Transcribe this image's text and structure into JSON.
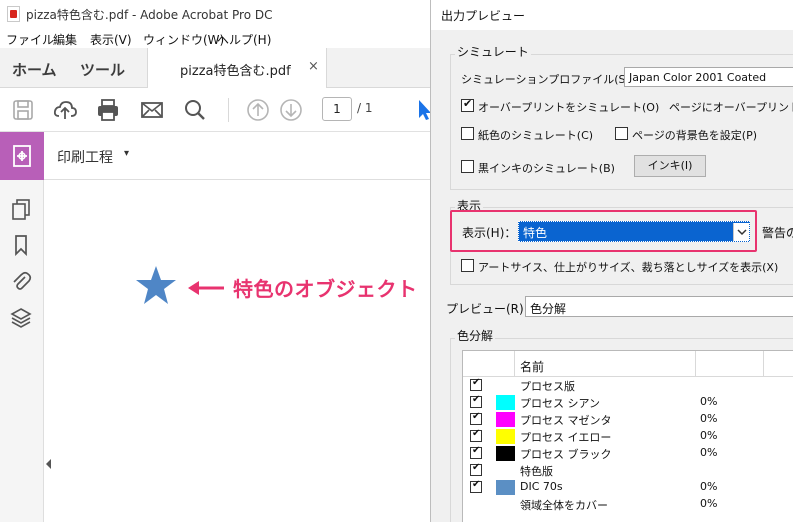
{
  "acrobat": {
    "title": "pizza特色含む.pdf - Adobe Acrobat Pro DC",
    "menu": [
      "ファイル",
      "編集",
      "表示(V)",
      "ウィンドウ(W)",
      "ヘルプ(H)"
    ],
    "nav": {
      "home": "ホーム",
      "tools": "ツール"
    },
    "doc_tab": {
      "label": "pizza特色含む.pdf",
      "close": "×"
    },
    "toolbar": {
      "icons": [
        "save-icon",
        "upload-icon",
        "print-icon",
        "mail-icon",
        "search-icon",
        "page-up-icon",
        "page-down-icon",
        "pointer-icon"
      ],
      "page_current": "1",
      "page_total": "/ 1"
    },
    "tool_strip": {
      "name": "印刷工程",
      "caret": "▾"
    },
    "left_rail_icons": [
      "pages-icon",
      "bookmark-icon",
      "attachment-icon",
      "layers-icon"
    ],
    "annotation": {
      "text": "特色のオブジェクト"
    },
    "colors": {
      "accent_purple": "#b85fb8",
      "star": "#4f86c6",
      "callout": "#e8336f",
      "pointer_blue": "#1a73e8"
    }
  },
  "dialog": {
    "title": "出力プレビュー",
    "simulate": {
      "group_label": "シミュレート",
      "profile_label": "シミュレーションプロファイル(S)：",
      "profile_value": "Japan Color 2001 Coated",
      "overprint_label": "オーバープリントをシミュレート(O)",
      "overprint_checked": true,
      "page_overprint_label": "ページにオーバープリント",
      "paper_color_label": "紙色のシミュレート(C)",
      "paper_color_checked": false,
      "page_bg_label": "ページの背景色を設定(P)",
      "page_bg_checked": false,
      "black_ink_label": "黒インキのシミュレート(B)",
      "black_ink_checked": false,
      "ink_button": "インキ(I)"
    },
    "display": {
      "group_label": "表示",
      "show_label": "表示(H)：",
      "show_value": "特色",
      "warning_label": "警告の",
      "boxes_label": "アートサイス、仕上がりサイズ、裁ち落としサイズを表示(X)",
      "boxes_checked": false
    },
    "preview": {
      "label": "プレビュー(R)：",
      "value": "色分解"
    },
    "separations": {
      "group_label": "色分解",
      "column_name": "名前",
      "rows": [
        {
          "name": "プロセス版",
          "checked": true,
          "swatch": "",
          "pct": ""
        },
        {
          "name": "プロセス シアン",
          "checked": true,
          "swatch": "#00ffff",
          "pct": "0%"
        },
        {
          "name": "プロセス マゼンタ",
          "checked": true,
          "swatch": "#ff00ff",
          "pct": "0%"
        },
        {
          "name": "プロセス イエロー",
          "checked": true,
          "swatch": "#ffff00",
          "pct": "0%"
        },
        {
          "name": "プロセス ブラック",
          "checked": true,
          "swatch": "#000000",
          "pct": "0%"
        },
        {
          "name": "特色版",
          "checked": true,
          "swatch": "",
          "pct": ""
        },
        {
          "name": "DIC 70s",
          "checked": true,
          "swatch": "#5b8fc4",
          "pct": "0%"
        },
        {
          "name": "領域全体をカバー",
          "checked": false,
          "swatch": "",
          "pct": "0%"
        }
      ]
    }
  }
}
